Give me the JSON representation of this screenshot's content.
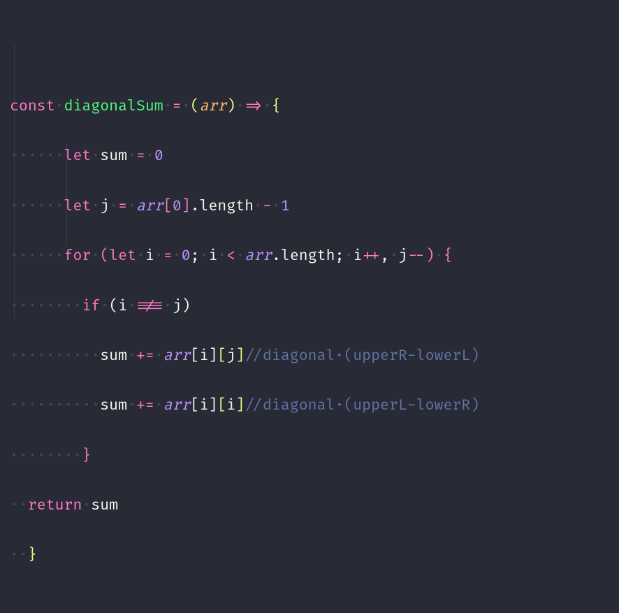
{
  "colors": {
    "bg": "#282a36",
    "fg": "#f8f8f2",
    "pink": "#ff79c6",
    "green": "#50fa7b",
    "purple": "#bd93f9",
    "orange": "#ffb86c",
    "yellow": "#f1fa8c",
    "comment": "#6272a4",
    "whitespace": "#44475a"
  },
  "tokens": {
    "const": "const",
    "let": "let",
    "for": "for",
    "if": "if",
    "return": "return",
    "fnName": "diagonalSum",
    "param": "arr",
    "sum": "sum",
    "j": "j",
    "i": "i",
    "length": "length",
    "zero": "0",
    "one": "1",
    "eq": "=",
    "plusEq": "+=",
    "minus": "-",
    "lt": "<",
    "neq": "!==",
    "inc": "++",
    "dec": "--",
    "arrow": "=>",
    "lparen": "(",
    "rparen": ")",
    "lbrace": "{",
    "rbrace": "}",
    "lbracket": "[",
    "rbracket": "]",
    "semi": ";",
    "comma": ",",
    "dotp": ".",
    "cmt1": "//diagonal·(upperR-lowerL)",
    "cmt2": "//diagonal·(upperL-lowerR)"
  },
  "ws": {
    "d6": "······",
    "d8": "········",
    "d10": "··········",
    "d2": "··",
    "sd": "·"
  }
}
